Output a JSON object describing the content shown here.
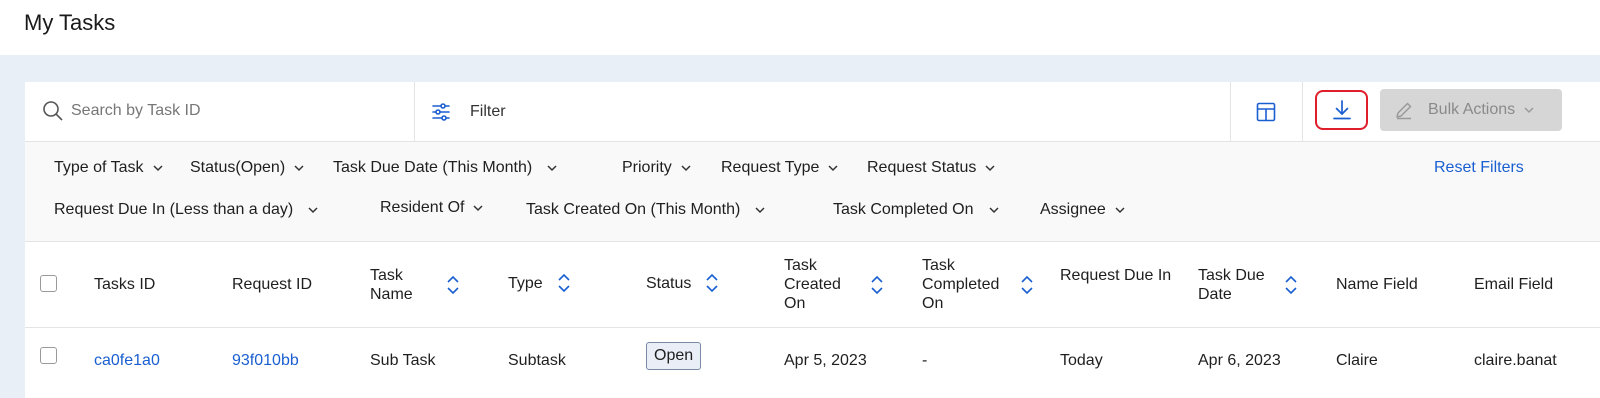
{
  "page": {
    "title": "My Tasks"
  },
  "toolbar": {
    "search_placeholder": "Search by Task ID",
    "filter_label": "Filter",
    "bulk_actions_label": "Bulk Actions"
  },
  "filters": {
    "row1": [
      "Type of Task",
      "Status(Open)",
      "Task Due Date (This Month)",
      "Priority",
      "Request Type",
      "Request Status"
    ],
    "row2": [
      "Request Due In (Less than a day)",
      "Resident Of",
      "Task Created On (This Month)",
      "Task Completed On",
      "Assignee"
    ],
    "reset_label": "Reset Filters"
  },
  "table": {
    "columns": [
      "Tasks ID",
      "Request ID",
      "Task Name",
      "Type",
      "Status",
      "Task Created On",
      "Task Completed On",
      "Request Due In",
      "Task Due Date",
      "Name Field",
      "Email Field"
    ],
    "rows": [
      {
        "task_id": "ca0fe1a0",
        "request_id": "93f010bb",
        "task_name": "Sub Task",
        "type": "Subtask",
        "status": "Open",
        "created_on": "Apr 5, 2023",
        "completed_on": "-",
        "request_due_in": "Today",
        "task_due_date": "Apr 6, 2023",
        "name": "Claire",
        "email": "claire.banat"
      }
    ]
  },
  "colors": {
    "accent": "#1a5fd1",
    "highlight": "#e01e2b",
    "background": "#e9eff6"
  },
  "icons": [
    "search-icon",
    "filter-sliders-icon",
    "columns-icon",
    "download-icon",
    "pencil-icon",
    "chevron-down-icon",
    "sort-icon"
  ]
}
